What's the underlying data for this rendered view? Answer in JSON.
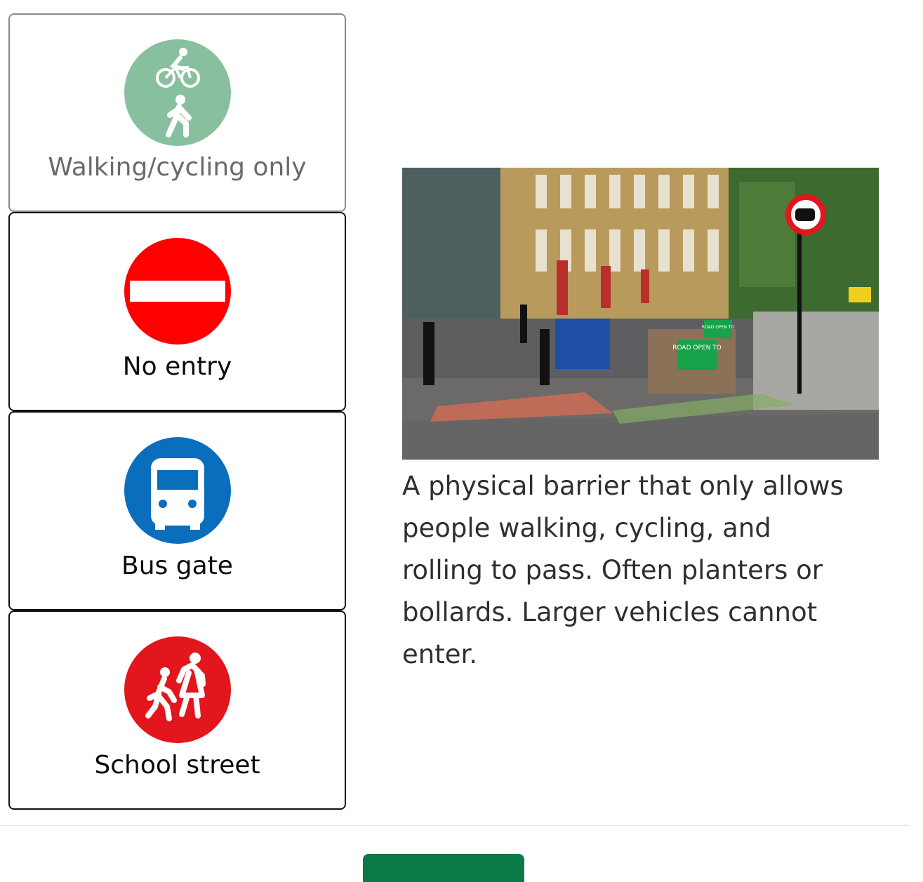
{
  "options": [
    {
      "label": "Walking/cycling only",
      "icon": "walking-cycling-icon",
      "color": "#88c09f",
      "selected": true
    },
    {
      "label": "No entry",
      "icon": "no-entry-icon",
      "color": "#ff0000",
      "selected": false
    },
    {
      "label": "Bus gate",
      "icon": "bus-icon",
      "color": "#0b6ebc",
      "selected": false
    },
    {
      "label": "School street",
      "icon": "school-children-icon",
      "color": "#e2161c",
      "selected": false
    }
  ],
  "detail": {
    "description": "A physical barrier that only allows people walking, cycling, and rolling to pass. Often planters or bollards. Larger vehicles cannot enter.",
    "photo_sign": {
      "top_label": "ROAD OPEN TO",
      "front_label": "ROAD OPEN TO"
    }
  },
  "colors": {
    "button": "#0b7a48",
    "divider": "#e3e3e3"
  }
}
